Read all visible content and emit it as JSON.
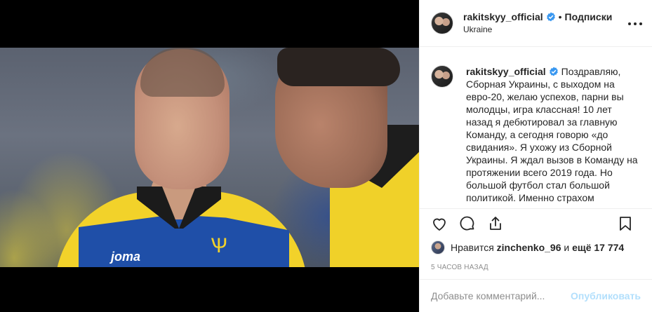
{
  "post": {
    "username": "rakitskyy_official",
    "follow_label": "Подписки",
    "separator": "•",
    "location": "Ukraine",
    "caption_text": "Поздравляю, Сборная Украины, с выходом на евро-20, желаю успехов, парни вы молодцы, игра классная! 10 лет назад я дебютировал за главную Команду, а сегодня говорю «до свидания». Я ухожу из Сборной Украины. Я ждал вызов в Команду на протяжении всего 2019 года. Но большой футбол стал большой политикой. Именно страхом",
    "likes": {
      "prefix": "Нравится",
      "user": "zinchenko_96",
      "middle": "и",
      "count": "ещё 17 774"
    },
    "timestamp": "5 ЧАСОВ НАЗАД"
  },
  "photo": {
    "brand_text": "joma",
    "crest_glyph": "Ѱ"
  },
  "comment": {
    "placeholder": "Добавьте комментарий...",
    "publish_label": "Опубликовать"
  },
  "icons": {
    "more": "more-options-icon",
    "verified": "verified-badge-icon",
    "like": "heart-icon",
    "comment": "comment-bubble-icon",
    "share": "share-icon",
    "save": "bookmark-icon"
  },
  "colors": {
    "verified_blue": "#3897f0",
    "publish_disabled": "#b2dffc",
    "muted_text": "#8e8e8e",
    "border": "#efefef"
  }
}
